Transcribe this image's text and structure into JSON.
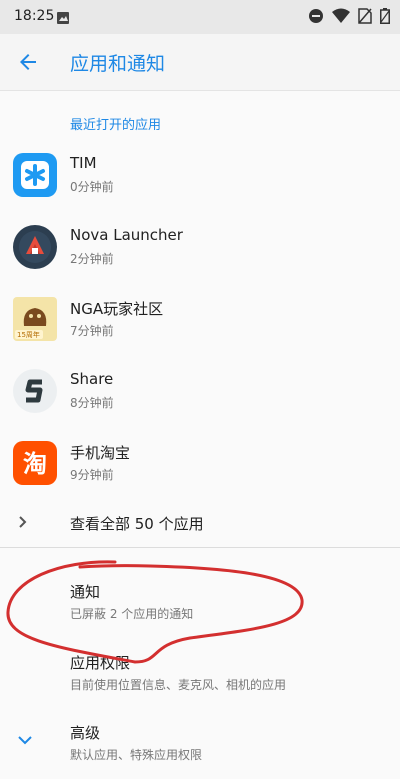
{
  "status_bar": {
    "time": "18:25"
  },
  "app_bar": {
    "title": "应用和通知"
  },
  "recent": {
    "label": "最近打开的应用",
    "apps": [
      {
        "name": "TIM",
        "time": "0分钟前",
        "icon": "tim-icon"
      },
      {
        "name": "Nova Launcher",
        "time": "2分钟前",
        "icon": "nova-launcher-icon"
      },
      {
        "name": "NGA玩家社区",
        "time": "7分钟前",
        "icon": "nga-icon",
        "icon_text": "15周年"
      },
      {
        "name": "Share",
        "time": "8分钟前",
        "icon": "share-icon"
      },
      {
        "name": "手机淘宝",
        "time": "9分钟前",
        "icon": "taobao-icon",
        "icon_text": "淘"
      }
    ]
  },
  "see_all": {
    "label": "查看全部 50 个应用"
  },
  "settings": {
    "notifications": {
      "title": "通知",
      "subtitle": "已屏蔽 2 个应用的通知"
    },
    "permissions": {
      "title": "应用权限",
      "subtitle": "目前使用位置信息、麦克风、相机的应用"
    },
    "advanced": {
      "title": "高级",
      "subtitle": "默认应用、特殊应用权限"
    }
  },
  "colors": {
    "accent": "#1e88e5",
    "annotation": "#d32f2f"
  }
}
